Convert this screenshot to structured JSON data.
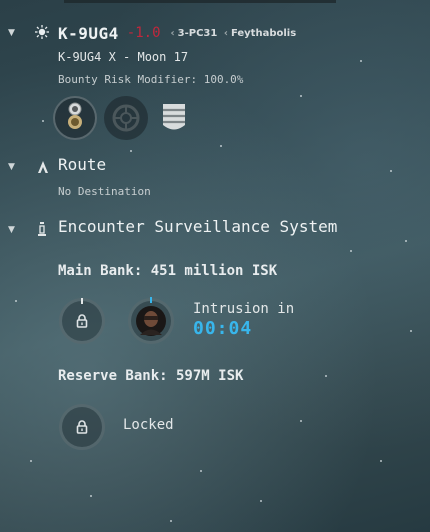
{
  "system": {
    "name": "K-9UG4",
    "security": "-1.0",
    "constellation": "3-PC31",
    "region": "Feythabolis",
    "location": "K-9UG4 X - Moon 17",
    "bounty_label": "Bounty Risk Modifier: 100.0%"
  },
  "route": {
    "title": "Route",
    "status": "No Destination"
  },
  "ess": {
    "title": "Encounter Surveillance System",
    "main_bank": "Main Bank: 451 million ISK",
    "intrusion_label": "Intrusion in",
    "intrusion_timer": "00:04",
    "reserve_bank": "Reserve Bank: 597M ISK",
    "reserve_status": "Locked"
  },
  "colors": {
    "security": "#c1273c",
    "timer": "#38b6ec"
  },
  "icons": {
    "system": "sun-icon",
    "route": "autopilot-icon",
    "ess": "ess-icon",
    "sovereignty": "sov-badge-icon",
    "hub": "hub-icon",
    "stack": "stack-icon"
  }
}
